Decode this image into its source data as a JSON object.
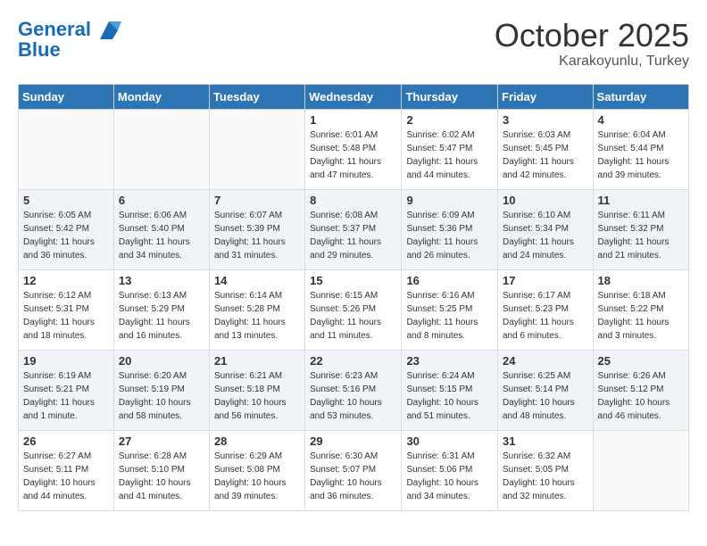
{
  "header": {
    "logo_line1": "General",
    "logo_line2": "Blue",
    "month": "October 2025",
    "location": "Karakoyunlu, Turkey"
  },
  "weekdays": [
    "Sunday",
    "Monday",
    "Tuesday",
    "Wednesday",
    "Thursday",
    "Friday",
    "Saturday"
  ],
  "weeks": [
    [
      {
        "num": "",
        "info": ""
      },
      {
        "num": "",
        "info": ""
      },
      {
        "num": "",
        "info": ""
      },
      {
        "num": "1",
        "info": "Sunrise: 6:01 AM\nSunset: 5:48 PM\nDaylight: 11 hours\nand 47 minutes."
      },
      {
        "num": "2",
        "info": "Sunrise: 6:02 AM\nSunset: 5:47 PM\nDaylight: 11 hours\nand 44 minutes."
      },
      {
        "num": "3",
        "info": "Sunrise: 6:03 AM\nSunset: 5:45 PM\nDaylight: 11 hours\nand 42 minutes."
      },
      {
        "num": "4",
        "info": "Sunrise: 6:04 AM\nSunset: 5:44 PM\nDaylight: 11 hours\nand 39 minutes."
      }
    ],
    [
      {
        "num": "5",
        "info": "Sunrise: 6:05 AM\nSunset: 5:42 PM\nDaylight: 11 hours\nand 36 minutes."
      },
      {
        "num": "6",
        "info": "Sunrise: 6:06 AM\nSunset: 5:40 PM\nDaylight: 11 hours\nand 34 minutes."
      },
      {
        "num": "7",
        "info": "Sunrise: 6:07 AM\nSunset: 5:39 PM\nDaylight: 11 hours\nand 31 minutes."
      },
      {
        "num": "8",
        "info": "Sunrise: 6:08 AM\nSunset: 5:37 PM\nDaylight: 11 hours\nand 29 minutes."
      },
      {
        "num": "9",
        "info": "Sunrise: 6:09 AM\nSunset: 5:36 PM\nDaylight: 11 hours\nand 26 minutes."
      },
      {
        "num": "10",
        "info": "Sunrise: 6:10 AM\nSunset: 5:34 PM\nDaylight: 11 hours\nand 24 minutes."
      },
      {
        "num": "11",
        "info": "Sunrise: 6:11 AM\nSunset: 5:32 PM\nDaylight: 11 hours\nand 21 minutes."
      }
    ],
    [
      {
        "num": "12",
        "info": "Sunrise: 6:12 AM\nSunset: 5:31 PM\nDaylight: 11 hours\nand 18 minutes."
      },
      {
        "num": "13",
        "info": "Sunrise: 6:13 AM\nSunset: 5:29 PM\nDaylight: 11 hours\nand 16 minutes."
      },
      {
        "num": "14",
        "info": "Sunrise: 6:14 AM\nSunset: 5:28 PM\nDaylight: 11 hours\nand 13 minutes."
      },
      {
        "num": "15",
        "info": "Sunrise: 6:15 AM\nSunset: 5:26 PM\nDaylight: 11 hours\nand 11 minutes."
      },
      {
        "num": "16",
        "info": "Sunrise: 6:16 AM\nSunset: 5:25 PM\nDaylight: 11 hours\nand 8 minutes."
      },
      {
        "num": "17",
        "info": "Sunrise: 6:17 AM\nSunset: 5:23 PM\nDaylight: 11 hours\nand 6 minutes."
      },
      {
        "num": "18",
        "info": "Sunrise: 6:18 AM\nSunset: 5:22 PM\nDaylight: 11 hours\nand 3 minutes."
      }
    ],
    [
      {
        "num": "19",
        "info": "Sunrise: 6:19 AM\nSunset: 5:21 PM\nDaylight: 11 hours\nand 1 minute."
      },
      {
        "num": "20",
        "info": "Sunrise: 6:20 AM\nSunset: 5:19 PM\nDaylight: 10 hours\nand 58 minutes."
      },
      {
        "num": "21",
        "info": "Sunrise: 6:21 AM\nSunset: 5:18 PM\nDaylight: 10 hours\nand 56 minutes."
      },
      {
        "num": "22",
        "info": "Sunrise: 6:23 AM\nSunset: 5:16 PM\nDaylight: 10 hours\nand 53 minutes."
      },
      {
        "num": "23",
        "info": "Sunrise: 6:24 AM\nSunset: 5:15 PM\nDaylight: 10 hours\nand 51 minutes."
      },
      {
        "num": "24",
        "info": "Sunrise: 6:25 AM\nSunset: 5:14 PM\nDaylight: 10 hours\nand 48 minutes."
      },
      {
        "num": "25",
        "info": "Sunrise: 6:26 AM\nSunset: 5:12 PM\nDaylight: 10 hours\nand 46 minutes."
      }
    ],
    [
      {
        "num": "26",
        "info": "Sunrise: 6:27 AM\nSunset: 5:11 PM\nDaylight: 10 hours\nand 44 minutes."
      },
      {
        "num": "27",
        "info": "Sunrise: 6:28 AM\nSunset: 5:10 PM\nDaylight: 10 hours\nand 41 minutes."
      },
      {
        "num": "28",
        "info": "Sunrise: 6:29 AM\nSunset: 5:08 PM\nDaylight: 10 hours\nand 39 minutes."
      },
      {
        "num": "29",
        "info": "Sunrise: 6:30 AM\nSunset: 5:07 PM\nDaylight: 10 hours\nand 36 minutes."
      },
      {
        "num": "30",
        "info": "Sunrise: 6:31 AM\nSunset: 5:06 PM\nDaylight: 10 hours\nand 34 minutes."
      },
      {
        "num": "31",
        "info": "Sunrise: 6:32 AM\nSunset: 5:05 PM\nDaylight: 10 hours\nand 32 minutes."
      },
      {
        "num": "",
        "info": ""
      }
    ]
  ]
}
